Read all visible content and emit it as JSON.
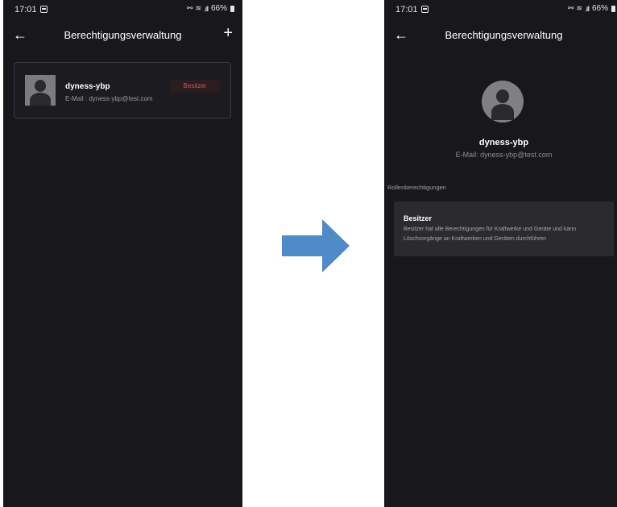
{
  "left_screen": {
    "status": {
      "time": "17:01",
      "battery": "66%"
    },
    "header": {
      "title": "Berechtigungsverwaltung"
    },
    "user": {
      "name": "dyness-ybp",
      "email": "E-Mail : dyness-ybp@test.com",
      "role_badge": "Besitzer"
    }
  },
  "right_screen": {
    "status": {
      "time": "17:01",
      "battery": "66%"
    },
    "header": {
      "title": "Berechtigungsverwaltung"
    },
    "user": {
      "name": "dyness-ybp",
      "email": "E-Mail: dyness-ybp@test.com"
    },
    "section_label": "Rollenberechtigungen",
    "role": {
      "title": "Besitzer",
      "description": "Besitzer hat alle Berechtigungen für Kraftwerke und Geräte und kann Löschvorgänge an Kraftwerken und Geräten durchführen"
    }
  },
  "colors": {
    "background": "#18181c",
    "badge_text": "#d2545a",
    "arrow": "#4f8ac9"
  },
  "icons": [
    "back-arrow-icon",
    "plus-icon",
    "user-avatar-icon",
    "calendar-icon",
    "signal-icon",
    "battery-icon"
  ]
}
